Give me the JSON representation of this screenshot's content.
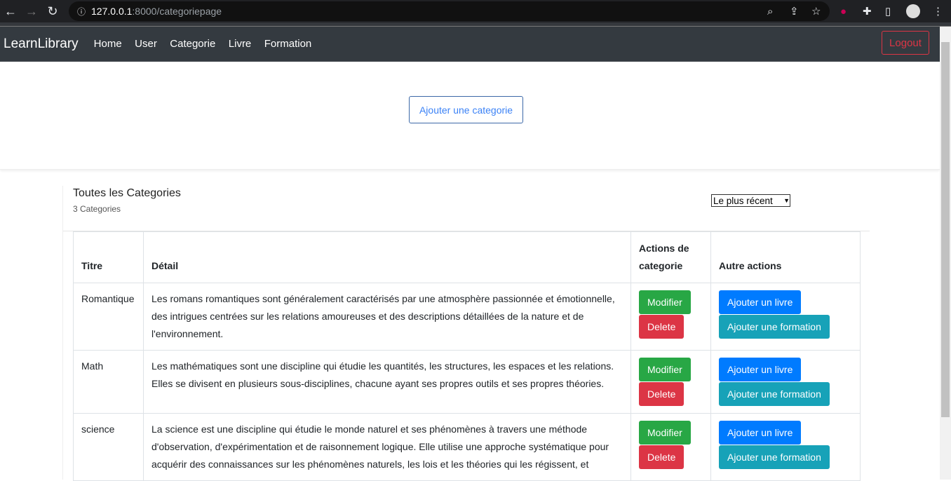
{
  "browser": {
    "url_host": "127.0.0.1",
    "url_path": ":8000/categoriepage"
  },
  "navbar": {
    "brand": "LearnLibrary",
    "links": [
      "Home",
      "User",
      "Categorie",
      "Livre",
      "Formation"
    ],
    "logout": "Logout"
  },
  "hero": {
    "add_button": "Ajouter une categorie"
  },
  "list": {
    "title": "Toutes les Categories",
    "count": "3 Categories",
    "sort": "Le plus récent"
  },
  "table": {
    "headers": [
      "Titre",
      "Détail",
      "Actions de categorie",
      "Autre actions"
    ],
    "rows": [
      {
        "titre": "Romantique",
        "detail": "Les romans romantiques sont généralement caractérisés par une atmosphère passionnée et émotionnelle, des intrigues centrées sur les relations amoureuses et des descriptions détaillées de la nature et de l'environnement."
      },
      {
        "titre": "Math",
        "detail": "Les mathématiques sont une discipline qui étudie les quantités, les structures, les espaces et les relations. Elles se divisent en plusieurs sous-disciplines, chacune ayant ses propres outils et ses propres théories."
      },
      {
        "titre": "science",
        "detail": "La science est une discipline qui étudie le monde naturel et ses phénomènes à travers une méthode d'observation, d'expérimentation et de raisonnement logique. Elle utilise une approche systématique pour acquérir des connaissances sur les phénomènes naturels, les lois et les théories qui les régissent, et"
      }
    ],
    "buttons": {
      "modifier": "Modifier",
      "delete": "Delete",
      "add_book": "Ajouter un livre",
      "add_training": "Ajouter une formation"
    }
  }
}
